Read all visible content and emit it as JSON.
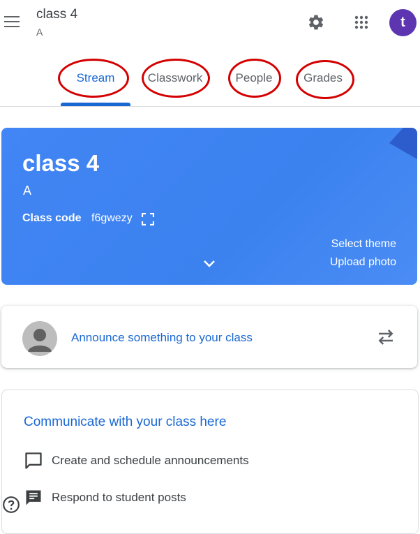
{
  "header": {
    "class_name": "class 4",
    "section": "A",
    "settings_icon": "gear-icon",
    "apps_icon": "apps-grid-icon",
    "avatar_letter": "t",
    "avatar_color": "#5e35b1"
  },
  "tabs": [
    {
      "label": "Stream",
      "active": true
    },
    {
      "label": "Classwork",
      "active": false
    },
    {
      "label": "People",
      "active": false
    },
    {
      "label": "Grades",
      "active": false
    }
  ],
  "banner": {
    "title": "class 4",
    "section": "A",
    "class_code_label": "Class code",
    "class_code": "f6gwezy",
    "select_theme": "Select theme",
    "upload_photo": "Upload photo",
    "color": "#4285f4"
  },
  "announce": {
    "placeholder": "Announce something to your class"
  },
  "info": {
    "title": "Communicate with your class here",
    "items": [
      {
        "icon": "comment-icon",
        "label": "Create and schedule announcements"
      },
      {
        "icon": "message-icon",
        "label": "Respond to student posts"
      }
    ]
  },
  "colors": {
    "accent": "#1967d2",
    "highlight_ring": "#d40000"
  }
}
